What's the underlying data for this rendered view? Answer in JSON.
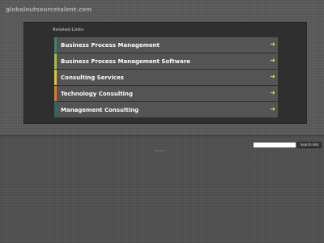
{
  "header": {
    "domain": "globaloutsourcetalent.com"
  },
  "panel": {
    "title": "Related Links",
    "links": [
      {
        "label": "Business Process Management",
        "accent": "#2e8a7a"
      },
      {
        "label": "Business Process Management Software",
        "accent": "#9cc33b"
      },
      {
        "label": "Consulting Services",
        "accent": "#e7c52a"
      },
      {
        "label": "Technology Consulting",
        "accent": "#e07a1f"
      },
      {
        "label": "Management Consulting",
        "accent": "#1f6d74"
      }
    ],
    "arrow_icon": "right-arrow-icon",
    "arrow_glyph": "➜",
    "arrow_color": "#c8e35a"
  },
  "search": {
    "input_value": "",
    "button_label": "Search Ads"
  },
  "footer": {
    "text": "Searchrly"
  }
}
